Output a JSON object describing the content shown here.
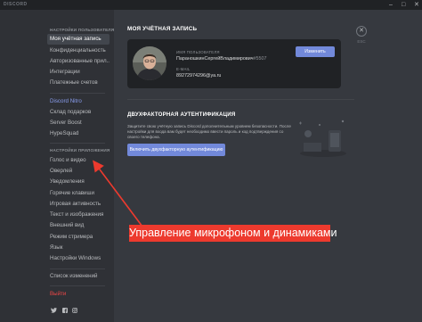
{
  "titlebar": {
    "brand": "DISCORD",
    "controls": [
      "–",
      "□",
      "✕"
    ]
  },
  "sidebar": {
    "user_settings_header": "НАСТРОЙКИ ПОЛЬЗОВАТЕЛЯ",
    "user_items": [
      "Моя учётная запись",
      "Конфиденциальность",
      "Авторизованные прил...",
      "Интеграции",
      "Платежные счетов"
    ],
    "nitro_items": [
      "Discord Nitro",
      "Склад подарков",
      "Server Boost",
      "HypeSquad"
    ],
    "app_settings_header": "НАСТРОЙКИ ПРИЛОЖЕНИЯ",
    "app_items": [
      "Голос и видео",
      "Оверлей",
      "Уведомления",
      "Горячие клавиши",
      "Игровая активность",
      "Текст и изображения",
      "Внешний вид",
      "Режим стримера",
      "Язык",
      "Настройки Windows"
    ],
    "changelog": "Список изменений",
    "logout": "Выйти"
  },
  "main": {
    "page_title": "МОЯ УЧЁТНАЯ ЗАПИСЬ",
    "close_label": "✕",
    "esc_label": "ESC",
    "account": {
      "username_label": "ИМЯ ПОЛЬЗОВАТЕЛЯ",
      "username": "ПараношкинСергейВладимирович",
      "discriminator": "#5507",
      "email_label": "E-MAIL",
      "email": "89272974296@ya.ru",
      "edit_label": "Изменить"
    },
    "twofa": {
      "title": "ДВУХФАКТОРНАЯ АУТЕНТИФИКАЦИЯ",
      "description": "Защитите свою учётную запись Discord дополнительным уровнем безопасности. После настройки для входа вам будет необходимо ввести пароль и код подтверждения со своего телефона.",
      "button_label": "Включить двухфакторную аутентификацию"
    }
  },
  "annotation": {
    "text": "Управление микрофоном и динамиками"
  },
  "colors": {
    "accent": "#7289da",
    "annotation": "#ed3a2e",
    "danger": "#f04747"
  },
  "icons": [
    "twitter-icon",
    "facebook-icon",
    "instagram-icon"
  ]
}
